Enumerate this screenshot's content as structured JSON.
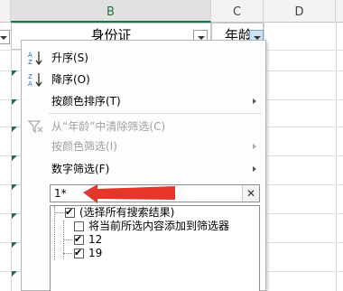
{
  "sheet": {
    "columns": [
      {
        "id": "col_b",
        "label": "B"
      },
      {
        "id": "col_c",
        "label": "C"
      },
      {
        "id": "col_d",
        "label": "D"
      }
    ],
    "cells": {
      "id_header": "身份证",
      "age_header": "年龄"
    }
  },
  "menu": {
    "sort_asc": "升序(S)",
    "sort_desc": "降序(O)",
    "sort_by_color": "按颜色排序(T)",
    "clear_filter": "从“年龄”中清除筛选(C)",
    "filter_by_color": "按颜色筛选(I)",
    "number_filters": "数字筛选(F)",
    "search": {
      "value": "1*",
      "clear_icon": "✕"
    },
    "list": [
      {
        "label": "(选择所有搜索结果)",
        "checked": true
      },
      {
        "label": "将当前所选内容添加到筛选器",
        "checked": false
      },
      {
        "label": "12",
        "checked": true
      },
      {
        "label": "19",
        "checked": true
      }
    ],
    "check_mark": "✔"
  },
  "icons": {
    "sort_asc": "sort-ascending-icon",
    "sort_desc": "sort-descending-icon",
    "clear_filter": "clear-filter-icon"
  },
  "colors": {
    "accent_green": "#217346",
    "annotation_arrow": "#e8352c",
    "disabled_text": "#a0a0a0"
  }
}
